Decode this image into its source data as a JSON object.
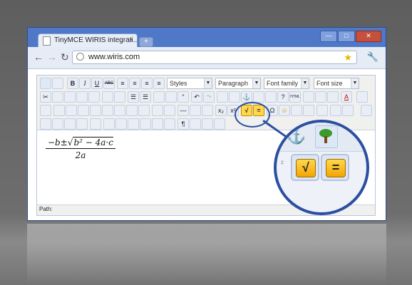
{
  "browser": {
    "tab_title": "TinyMCE WIRIS integrati...",
    "tab_close": "×",
    "new_tab": "+",
    "url": "www.wiris.com",
    "win_min": "—",
    "win_max": "□",
    "win_close": "✕"
  },
  "nav": {
    "back": "←",
    "forward": "→",
    "reload": "↻"
  },
  "toolbar": {
    "styles_label": "Styles",
    "paragraph_label": "Paragraph",
    "fontfamily_label": "Font family",
    "fontsize_label": "Font size",
    "bold": "B",
    "italic": "I",
    "underline": "U",
    "strike": "ABC",
    "sqrt_icon": "√",
    "equals_icon": "=",
    "omega": "Ω",
    "smiley": "☺"
  },
  "editor": {
    "formula": {
      "num_prefix": "−b±",
      "sqrt_content": "b² − 4a·c",
      "denominator": "2a"
    },
    "status_path": "Path:"
  },
  "magnifier": {
    "sqrt_icon": "√",
    "equals_icon": "=",
    "side_glyph": "²"
  }
}
